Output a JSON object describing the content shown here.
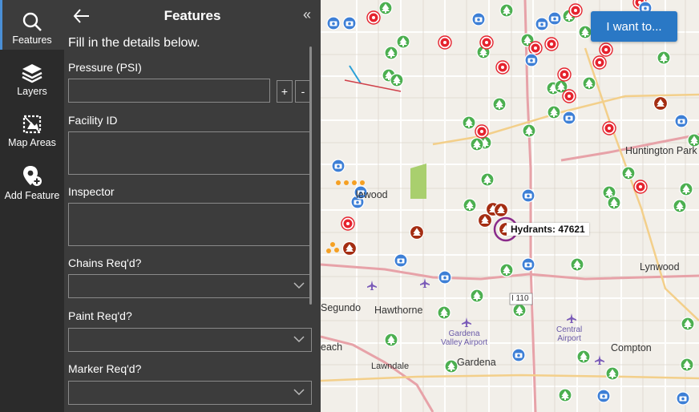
{
  "rail": {
    "items": [
      {
        "label": "Features",
        "icon": "search-icon"
      },
      {
        "label": "Layers",
        "icon": "layers-icon"
      },
      {
        "label": "Map Areas",
        "icon": "map-areas-icon"
      },
      {
        "label": "Add Feature",
        "icon": "add-location-icon"
      }
    ]
  },
  "panel": {
    "title": "Features",
    "instructions": "Fill in the details below.",
    "fields": {
      "pressure": {
        "label": "Pressure (PSI)",
        "value": "",
        "plus": "+",
        "minus": "-"
      },
      "facility_id": {
        "label": "Facility ID",
        "value": ""
      },
      "inspector": {
        "label": "Inspector",
        "value": ""
      },
      "chains": {
        "label": "Chains Req'd?",
        "value": ""
      },
      "paint": {
        "label": "Paint Req'd?",
        "value": ""
      },
      "marker": {
        "label": "Marker Req'd?",
        "value": ""
      }
    }
  },
  "map": {
    "places": [
      "lewood",
      "Huntington Park",
      "Lynwood",
      "Segundo",
      "Hawthorne",
      "each",
      "Lawndale",
      "Gardena",
      "Compton"
    ],
    "airports": {
      "gardena": "Gardena\nValley Airport",
      "central": "Central\nAirport"
    },
    "highway": "I 110",
    "callout": "Hydrants: 47621",
    "i_want_button": "I want to...",
    "colors": {
      "hydrant_red": "#e5232e",
      "tree_green": "#4caf50",
      "camera_blue": "#3d7fd6",
      "selected_brown": "#a42d12",
      "panel": "#3c3c3c",
      "accent": "#2a78c5"
    }
  }
}
